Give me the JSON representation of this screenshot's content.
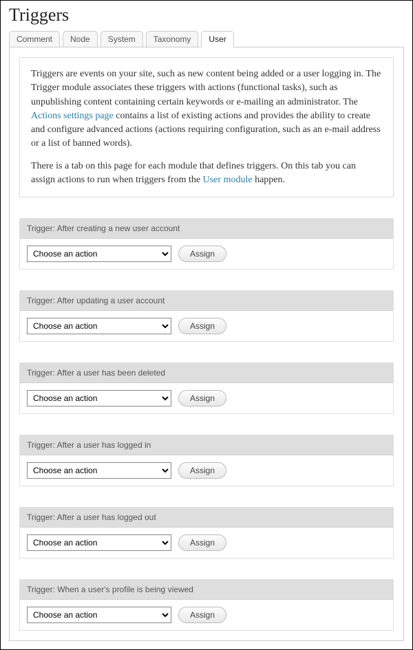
{
  "page": {
    "title": "Triggers"
  },
  "tabs": [
    {
      "label": "Comment",
      "active": false
    },
    {
      "label": "Node",
      "active": false
    },
    {
      "label": "System",
      "active": false
    },
    {
      "label": "Taxonomy",
      "active": false
    },
    {
      "label": "User",
      "active": true
    }
  ],
  "help": {
    "para1_a": "Triggers are events on your site, such as new content being added or a user logging in. The Trigger module associates these triggers with actions (functional tasks), such as unpublishing content containing certain keywords or e-mailing an administrator. The ",
    "link1": "Actions settings page",
    "para1_b": " contains a list of existing actions and provides the ability to create and configure advanced actions (actions requiring configuration, such as an e-mail address or a list of banned words).",
    "para2_a": "There is a tab on this page for each module that defines triggers. On this tab you can assign actions to run when triggers from the ",
    "link2": "User module",
    "para2_b": " happen."
  },
  "shared": {
    "select_placeholder": "Choose an action",
    "assign_label": "Assign"
  },
  "triggers": [
    {
      "title": "Trigger: After creating a new user account"
    },
    {
      "title": "Trigger: After updating a user account"
    },
    {
      "title": "Trigger: After a user has been deleted"
    },
    {
      "title": "Trigger: After a user has logged in"
    },
    {
      "title": "Trigger: After a user has logged out"
    },
    {
      "title": "Trigger: When a user's profile is being viewed"
    }
  ]
}
